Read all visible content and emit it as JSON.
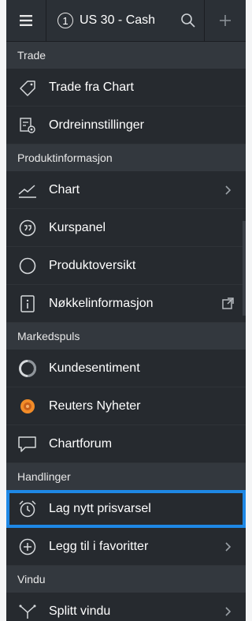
{
  "header": {
    "tab_number": "1",
    "tab_label": "US 30 - Cash"
  },
  "sections": [
    {
      "title": "Trade",
      "items": [
        {
          "label": "Trade fra Chart",
          "icon": "tag-icon"
        },
        {
          "label": "Ordreinnstillinger",
          "icon": "order-settings-icon"
        }
      ]
    },
    {
      "title": "Produktinformasjon",
      "items": [
        {
          "label": "Chart",
          "icon": "chart-line-icon",
          "trail": "chevron-right-icon"
        },
        {
          "label": "Kurspanel",
          "icon": "quote-icon"
        },
        {
          "label": "Produktoversikt",
          "icon": "circle-icon"
        },
        {
          "label": "Nøkkelinformasjon",
          "icon": "info-icon",
          "trail": "external-link-icon"
        }
      ]
    },
    {
      "title": "Markedspuls",
      "items": [
        {
          "label": "Kundesentiment",
          "icon": "sentiment-icon"
        },
        {
          "label": "Reuters Nyheter",
          "icon": "reuters-logo-icon"
        },
        {
          "label": "Chartforum",
          "icon": "chat-icon"
        }
      ]
    },
    {
      "title": "Handlinger",
      "items": [
        {
          "label": "Lag nytt prisvarsel",
          "icon": "alarm-clock-icon"
        },
        {
          "label": "Legg til i favoritter",
          "icon": "plus-circle-icon",
          "trail": "chevron-right-icon"
        }
      ]
    },
    {
      "title": "Vindu",
      "items": [
        {
          "label": "Splitt vindu",
          "icon": "split-icon",
          "trail": "chevron-right-icon"
        }
      ]
    }
  ],
  "colors": {
    "highlight": "#1e88e5",
    "reuters": "#f28c28"
  }
}
